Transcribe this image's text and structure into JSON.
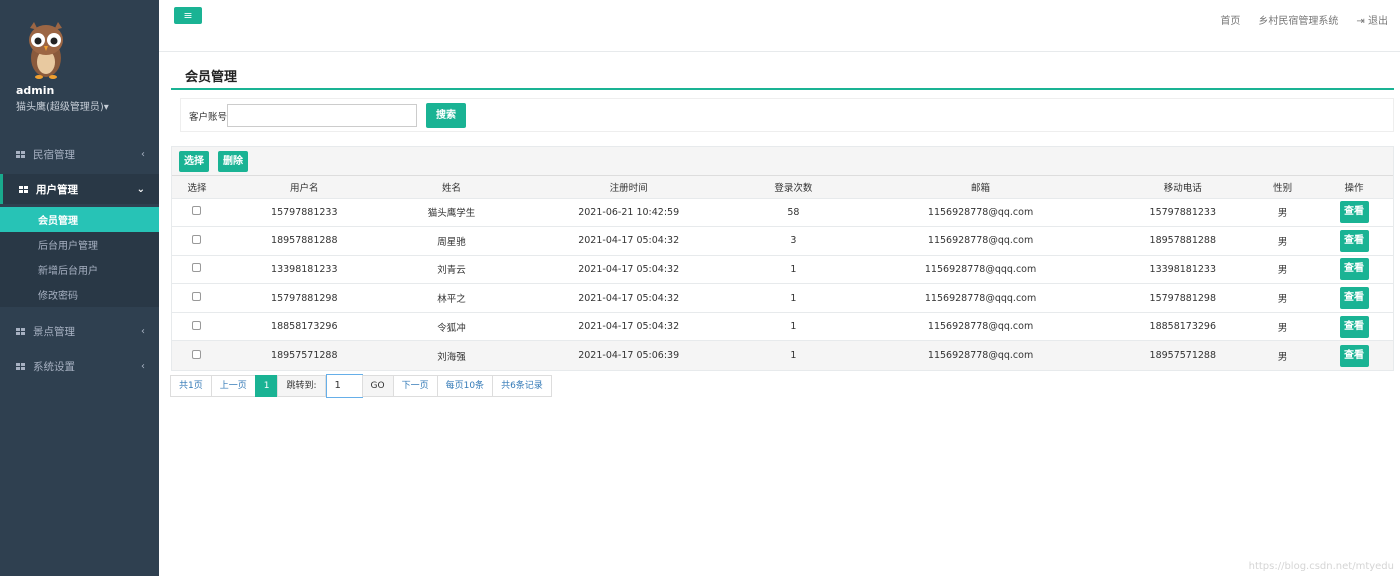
{
  "sidebar": {
    "username": "admin",
    "role": "猫头鹰(超级管理员)▾",
    "menu": [
      {
        "label": "民宿管理",
        "chevron": "‹"
      },
      {
        "label": "用户管理",
        "chevron": "⌄"
      },
      {
        "label": "景点管理",
        "chevron": "‹"
      },
      {
        "label": "系统设置",
        "chevron": "‹"
      }
    ],
    "submenu": [
      "会员管理",
      "后台用户管理",
      "新增后台用户",
      "修改密码"
    ]
  },
  "topbar": {
    "menu_icon": "≡",
    "home": "首页",
    "system_name": "乡村民宿管理系统",
    "logout_icon": "⇥",
    "logout": "退出"
  },
  "page": {
    "title": "会员管理"
  },
  "search": {
    "label": "客户账号",
    "value": "",
    "button": "搜索"
  },
  "actions": {
    "select": "选择",
    "delete": "删除"
  },
  "table": {
    "headers": [
      "选择",
      "用户名",
      "姓名",
      "注册时间",
      "登录次数",
      "邮箱",
      "移动电话",
      "性别",
      "操作"
    ],
    "view_label": "查看",
    "rows": [
      [
        "15797881233",
        "猫头鹰学生",
        "2021-06-21 10:42:59",
        "58",
        "1156928778@qq.com",
        "15797881233",
        "男"
      ],
      [
        "18957881288",
        "周星驰",
        "2021-04-17 05:04:32",
        "3",
        "1156928778@qq.com",
        "18957881288",
        "男"
      ],
      [
        "13398181233",
        "刘青云",
        "2021-04-17 05:04:32",
        "1",
        "1156928778@qqq.com",
        "13398181233",
        "男"
      ],
      [
        "15797881298",
        "林平之",
        "2021-04-17 05:04:32",
        "1",
        "1156928778@qqq.com",
        "15797881298",
        "男"
      ],
      [
        "18858173296",
        "令狐冲",
        "2021-04-17 05:04:32",
        "1",
        "1156928778@qq.com",
        "18858173296",
        "男"
      ],
      [
        "18957571288",
        "刘海强",
        "2021-04-17 05:06:39",
        "1",
        "1156928778@qq.com",
        "18957571288",
        "男"
      ]
    ]
  },
  "pager": {
    "total_pages": "共1页",
    "prev": "上一页",
    "current": "1",
    "jump_label": "跳转到:",
    "jump_value": "1",
    "go": "GO",
    "next": "下一页",
    "per_page": "每页10条",
    "total_records": "共6条记录"
  },
  "watermark": "https://blog.csdn.net/mtyedu"
}
